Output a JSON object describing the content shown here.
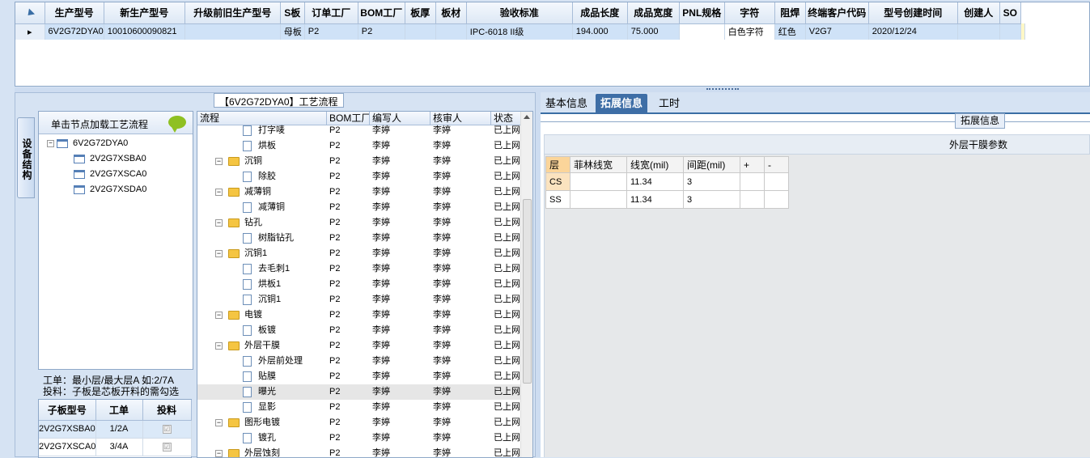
{
  "top_grid": {
    "columns": [
      "生产型号",
      "新生产型号",
      "升级前旧生产型号",
      "S板",
      "订单工厂",
      "BOM工厂",
      "板厚",
      "板材",
      "验收标准",
      "成品长度",
      "成品宽度",
      "PNL规格",
      "字符",
      "阻焊",
      "终端客户代码",
      "型号创建时间",
      "创建人",
      "SO"
    ],
    "row": [
      "6V2G72DYA0",
      "10010600090821",
      "",
      "母板",
      "P2",
      "P2",
      "",
      "",
      "IPC-6018 II级",
      "194.000",
      "75.000",
      "",
      "白色字符",
      "红色",
      "V2G7",
      "2020/12/24",
      "",
      ""
    ],
    "row_marker": "▸"
  },
  "left": {
    "group_title": "【6V2G72DYA0】工艺流程",
    "side_tab": "设备结构",
    "tree_header": "单击节点加载工艺流程",
    "tree": {
      "root": "6V2G72DYA0",
      "children": [
        "2V2G7XSBA0",
        "2V2G7XSCA0",
        "2V2G7XSDA0"
      ]
    },
    "info_line1": "工单：最小层/最大层A 如:2/7A",
    "info_line2": "投料：子板是芯板开料的需勾选",
    "sub_grid": {
      "headers": [
        "子板型号",
        "工单",
        "投料"
      ],
      "rows": [
        {
          "model": "2V2G7XSBA0",
          "order": "1/2A",
          "check": "☑"
        },
        {
          "model": "2V2G7XSCA0",
          "order": "3/4A",
          "check": "☑"
        }
      ]
    }
  },
  "process": {
    "headers": [
      "流程",
      "BOM工厂",
      "编写人",
      "核审人",
      "状态"
    ],
    "rows": [
      {
        "name": "打字唛",
        "level": 2,
        "bom": "P2",
        "writer": "李婷",
        "reviewer": "李婷",
        "status": "已上网"
      },
      {
        "name": "烘板",
        "level": 2,
        "bom": "P2",
        "writer": "李婷",
        "reviewer": "李婷",
        "status": "已上网"
      },
      {
        "name": "沉铜",
        "level": 1,
        "bom": "P2",
        "writer": "李婷",
        "reviewer": "李婷",
        "status": "已上网"
      },
      {
        "name": "除胶",
        "level": 2,
        "bom": "P2",
        "writer": "李婷",
        "reviewer": "李婷",
        "status": "已上网"
      },
      {
        "name": "减薄铜",
        "level": 1,
        "bom": "P2",
        "writer": "李婷",
        "reviewer": "李婷",
        "status": "已上网"
      },
      {
        "name": "减薄铜",
        "level": 2,
        "bom": "P2",
        "writer": "李婷",
        "reviewer": "李婷",
        "status": "已上网"
      },
      {
        "name": "钻孔",
        "level": 1,
        "bom": "P2",
        "writer": "李婷",
        "reviewer": "李婷",
        "status": "已上网"
      },
      {
        "name": "树脂钻孔",
        "level": 2,
        "bom": "P2",
        "writer": "李婷",
        "reviewer": "李婷",
        "status": "已上网"
      },
      {
        "name": "沉铜1",
        "level": 1,
        "bom": "P2",
        "writer": "李婷",
        "reviewer": "李婷",
        "status": "已上网"
      },
      {
        "name": "去毛刺1",
        "level": 2,
        "bom": "P2",
        "writer": "李婷",
        "reviewer": "李婷",
        "status": "已上网"
      },
      {
        "name": "烘板1",
        "level": 2,
        "bom": "P2",
        "writer": "李婷",
        "reviewer": "李婷",
        "status": "已上网"
      },
      {
        "name": "沉铜1",
        "level": 2,
        "bom": "P2",
        "writer": "李婷",
        "reviewer": "李婷",
        "status": "已上网"
      },
      {
        "name": "电镀",
        "level": 1,
        "bom": "P2",
        "writer": "李婷",
        "reviewer": "李婷",
        "status": "已上网"
      },
      {
        "name": "板镀",
        "level": 2,
        "bom": "P2",
        "writer": "李婷",
        "reviewer": "李婷",
        "status": "已上网"
      },
      {
        "name": "外层干膜",
        "level": 1,
        "bom": "P2",
        "writer": "李婷",
        "reviewer": "李婷",
        "status": "已上网"
      },
      {
        "name": "外层前处理",
        "level": 2,
        "bom": "P2",
        "writer": "李婷",
        "reviewer": "李婷",
        "status": "已上网"
      },
      {
        "name": "贴膜",
        "level": 2,
        "bom": "P2",
        "writer": "李婷",
        "reviewer": "李婷",
        "status": "已上网"
      },
      {
        "name": "曝光",
        "level": 2,
        "bom": "P2",
        "writer": "李婷",
        "reviewer": "李婷",
        "status": "已上网",
        "selected": true
      },
      {
        "name": "显影",
        "level": 2,
        "bom": "P2",
        "writer": "李婷",
        "reviewer": "李婷",
        "status": "已上网"
      },
      {
        "name": "图形电镀",
        "level": 1,
        "bom": "P2",
        "writer": "李婷",
        "reviewer": "李婷",
        "status": "已上网"
      },
      {
        "name": "镀孔",
        "level": 2,
        "bom": "P2",
        "writer": "李婷",
        "reviewer": "李婷",
        "status": "已上网"
      },
      {
        "name": "外层蚀刻",
        "level": 1,
        "bom": "P2",
        "writer": "李婷",
        "reviewer": "李婷",
        "status": "已上网"
      }
    ]
  },
  "right": {
    "tabs": [
      "基本信息",
      "拓展信息",
      "工时"
    ],
    "active_tab": 1,
    "ext_label": "拓展信息",
    "param_title": "外层干膜参数",
    "param_headers": [
      "层",
      "菲林线宽",
      "线宽(mil)",
      "间距(mil)",
      "+",
      "-"
    ],
    "param_rows": [
      [
        "CS",
        "",
        "11.34",
        "3",
        "",
        ""
      ],
      [
        "SS",
        "",
        "11.34",
        "3",
        "",
        ""
      ]
    ]
  }
}
